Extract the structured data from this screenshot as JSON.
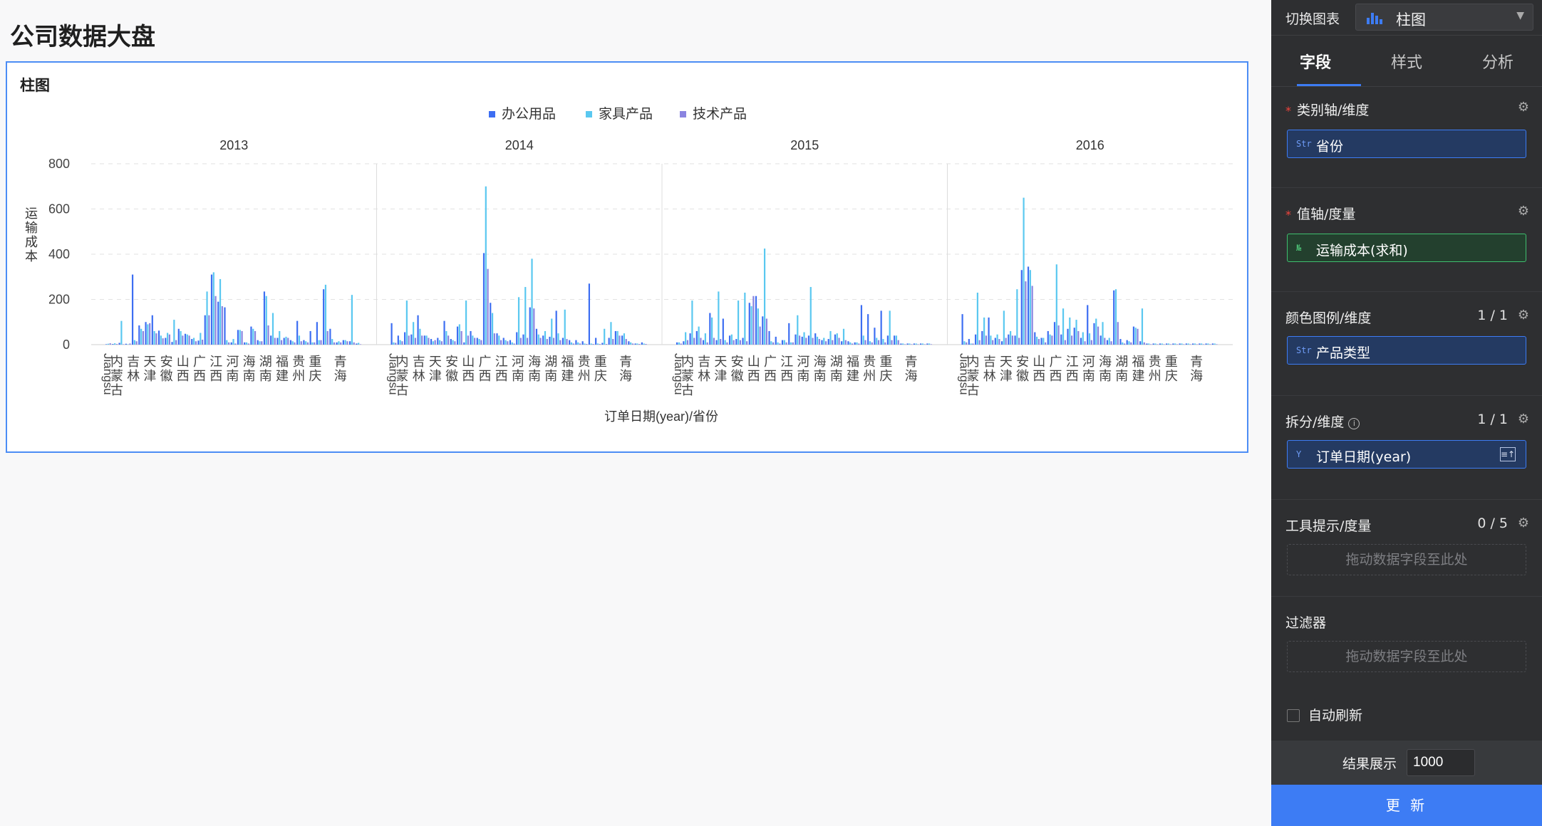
{
  "page_title": "公司数据大盘",
  "chart_card_title": "柱图",
  "chart_data": {
    "type": "bar",
    "title": "柱图",
    "xlabel": "订单日期(year)/省份",
    "ylabel": "运输成本",
    "ylim": [
      0,
      800
    ],
    "yticks": [
      0,
      200,
      400,
      600,
      800
    ],
    "grid": true,
    "legend_position": "top",
    "legend": [
      "办公用品",
      "家具产品",
      "技术产品"
    ],
    "colors": [
      "#3d6ef2",
      "#5ac8f0",
      "#8a84e0"
    ],
    "facets": [
      "2013",
      "2014",
      "2015",
      "2016"
    ],
    "province_labels": [
      "Jiangsu",
      "内蒙古",
      "吉林",
      "天津",
      "安徽",
      "山西",
      "广西",
      "江西",
      "河南",
      "海南",
      "湖南",
      "福建",
      "贵州",
      "重庆",
      "青海"
    ],
    "panels": [
      {
        "year": "2013",
        "values": [
          [
            2,
            4,
            6
          ],
          [
            3,
            6,
            3
          ],
          [
            8,
            105,
            2
          ],
          [
            4,
            2,
            5
          ],
          [
            310,
            20,
            15
          ],
          [
            85,
            70,
            60
          ],
          [
            100,
            90,
            95
          ],
          [
            130,
            60,
            50
          ],
          [
            62,
            40,
            28
          ],
          [
            30,
            52,
            45
          ],
          [
            12,
            110,
            20
          ],
          [
            70,
            60,
            40
          ],
          [
            48,
            45,
            40
          ],
          [
            25,
            30,
            15
          ],
          [
            18,
            52,
            22
          ],
          [
            130,
            235,
            130
          ],
          [
            310,
            320,
            215
          ],
          [
            190,
            290,
            170
          ],
          [
            165,
            20,
            10
          ],
          [
            10,
            25,
            5
          ],
          [
            65,
            65,
            60
          ],
          [
            10,
            10,
            5
          ],
          [
            80,
            70,
            60
          ],
          [
            20,
            15,
            15
          ],
          [
            235,
            215,
            85
          ],
          [
            40,
            140,
            30
          ],
          [
            30,
            60,
            20
          ],
          [
            30,
            35,
            30
          ],
          [
            20,
            15,
            10
          ],
          [
            105,
            40,
            15
          ],
          [
            20,
            15,
            10
          ],
          [
            60,
            10,
            10
          ],
          [
            100,
            20,
            20
          ],
          [
            245,
            265,
            60
          ],
          [
            70,
            25,
            10
          ],
          [
            10,
            15,
            10
          ],
          [
            20,
            20,
            15
          ],
          [
            15,
            220,
            10
          ],
          [
            5,
            8,
            2
          ]
        ]
      },
      {
        "year": "2014",
        "values": [
          [
            95,
            10,
            8
          ],
          [
            40,
            20,
            15
          ],
          [
            55,
            195,
            40
          ],
          [
            45,
            100,
            30
          ],
          [
            130,
            70,
            40
          ],
          [
            40,
            40,
            30
          ],
          [
            25,
            15,
            20
          ],
          [
            30,
            20,
            15
          ],
          [
            105,
            60,
            40
          ],
          [
            25,
            20,
            15
          ],
          [
            80,
            90,
            60
          ],
          [
            10,
            195,
            40
          ],
          [
            60,
            40,
            30
          ],
          [
            30,
            25,
            20
          ],
          [
            405,
            700,
            335
          ],
          [
            185,
            140,
            50
          ],
          [
            50,
            40,
            20
          ],
          [
            30,
            20,
            15
          ],
          [
            20,
            10,
            5
          ],
          [
            55,
            210,
            30
          ],
          [
            45,
            255,
            30
          ],
          [
            165,
            380,
            160
          ],
          [
            70,
            45,
            30
          ],
          [
            40,
            60,
            25
          ],
          [
            35,
            115,
            30
          ],
          [
            150,
            50,
            20
          ],
          [
            30,
            155,
            25
          ],
          [
            20,
            10,
            5
          ],
          [
            20,
            10,
            5
          ],
          [
            15,
            5,
            3
          ],
          [
            270,
            5,
            3
          ],
          [
            30,
            5,
            3
          ],
          [
            8,
            70,
            3
          ],
          [
            30,
            100,
            25
          ],
          [
            60,
            60,
            40
          ],
          [
            40,
            50,
            25
          ],
          [
            15,
            10,
            5
          ],
          [
            5,
            5,
            3
          ],
          [
            10,
            5,
            3
          ]
        ]
      },
      {
        "year": "2015",
        "values": [
          [
            10,
            10,
            5
          ],
          [
            15,
            55,
            20
          ],
          [
            50,
            195,
            30
          ],
          [
            60,
            80,
            30
          ],
          [
            20,
            50,
            10
          ],
          [
            140,
            120,
            30
          ],
          [
            20,
            235,
            25
          ],
          [
            115,
            20,
            10
          ],
          [
            40,
            45,
            20
          ],
          [
            25,
            195,
            20
          ],
          [
            30,
            230,
            15
          ],
          [
            185,
            170,
            215
          ],
          [
            215,
            160,
            80
          ],
          [
            125,
            425,
            115
          ],
          [
            60,
            15,
            10
          ],
          [
            35,
            10,
            5
          ],
          [
            20,
            20,
            10
          ],
          [
            95,
            10,
            10
          ],
          [
            45,
            130,
            40
          ],
          [
            35,
            55,
            30
          ],
          [
            40,
            255,
            30
          ],
          [
            50,
            35,
            25
          ],
          [
            20,
            30,
            15
          ],
          [
            25,
            60,
            20
          ],
          [
            45,
            50,
            30
          ],
          [
            15,
            70,
            20
          ],
          [
            15,
            10,
            5
          ],
          [
            10,
            10,
            5
          ],
          [
            175,
            40,
            20
          ],
          [
            135,
            15,
            10
          ],
          [
            75,
            30,
            20
          ],
          [
            150,
            25,
            10
          ],
          [
            40,
            150,
            20
          ],
          [
            40,
            40,
            20
          ],
          [
            5,
            5,
            2
          ],
          [
            5,
            5,
            2
          ],
          [
            5,
            5,
            2
          ],
          [
            5,
            5,
            2
          ],
          [
            5,
            5,
            2
          ]
        ]
      },
      {
        "year": "2016",
        "values": [
          [
            135,
            15,
            10
          ],
          [
            25,
            5,
            5
          ],
          [
            45,
            230,
            20
          ],
          [
            60,
            120,
            40
          ],
          [
            120,
            40,
            20
          ],
          [
            30,
            45,
            25
          ],
          [
            15,
            150,
            30
          ],
          [
            45,
            60,
            40
          ],
          [
            40,
            245,
            30
          ],
          [
            330,
            650,
            280
          ],
          [
            345,
            330,
            260
          ],
          [
            55,
            35,
            25
          ],
          [
            30,
            30,
            10
          ],
          [
            60,
            45,
            40
          ],
          [
            100,
            355,
            85
          ],
          [
            45,
            160,
            20
          ],
          [
            70,
            120,
            40
          ],
          [
            75,
            110,
            60
          ],
          [
            30,
            55,
            15
          ],
          [
            175,
            50,
            20
          ],
          [
            95,
            115,
            80
          ],
          [
            40,
            100,
            30
          ],
          [
            20,
            30,
            15
          ],
          [
            240,
            245,
            100
          ],
          [
            25,
            10,
            5
          ],
          [
            20,
            15,
            10
          ],
          [
            80,
            75,
            70
          ],
          [
            15,
            160,
            10
          ],
          [
            5,
            5,
            2
          ],
          [
            5,
            5,
            2
          ],
          [
            5,
            5,
            2
          ],
          [
            5,
            5,
            2
          ],
          [
            5,
            5,
            2
          ],
          [
            5,
            5,
            2
          ],
          [
            5,
            5,
            2
          ],
          [
            5,
            5,
            2
          ],
          [
            5,
            5,
            2
          ],
          [
            5,
            5,
            2
          ],
          [
            5,
            5,
            2
          ]
        ]
      }
    ]
  },
  "panel": {
    "switch_label": "切换图表",
    "chart_type_value": "柱图",
    "tabs": [
      "字段",
      "样式",
      "分析"
    ],
    "category_axis": {
      "title": "类别轴/维度",
      "field_tag": "Str",
      "field": "省份"
    },
    "value_axis": {
      "title": "值轴/度量",
      "field_tag": "№",
      "field": "运输成本(求和)"
    },
    "color_legend": {
      "title": "颜色图例/维度",
      "count": "1 / 1",
      "field_tag": "Str",
      "field": "产品类型"
    },
    "split": {
      "title": "拆分/维度",
      "count": "1 / 1",
      "field_tag": "Y",
      "field": "订单日期(year)"
    },
    "tooltip": {
      "title": "工具提示/度量",
      "count": "0 / 5",
      "placeholder": "拖动数据字段至此处"
    },
    "filter": {
      "title": "过滤器",
      "placeholder": "拖动数据字段至此处"
    },
    "auto_refresh": "自动刷新",
    "result_label": "结果展示",
    "result_value": "1000",
    "update_button": "更 新"
  }
}
